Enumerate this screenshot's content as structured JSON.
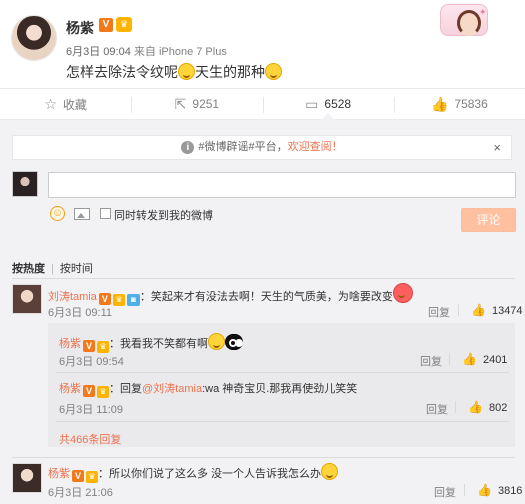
{
  "post": {
    "author": "杨紫",
    "vip_badge": "V",
    "date": "6月3日 09:04",
    "source_prefix": "来自",
    "source": "iPhone 7 Plus",
    "text_part1": "怎样去除法令纹呢",
    "text_part2": "天生的那种"
  },
  "actions": [
    {
      "icon": "star-icon",
      "label": "收藏"
    },
    {
      "icon": "repost-icon",
      "label": "9251"
    },
    {
      "icon": "comment-icon",
      "label": "6528"
    },
    {
      "icon": "like-icon",
      "label": "75836"
    }
  ],
  "notice": {
    "text": "#微博辟谣#平台，",
    "link": "欢迎查阅！",
    "close": "×"
  },
  "composer": {
    "repost_label": "同时转发到我的微博",
    "submit_label": "评论"
  },
  "sort": {
    "hot": "按热度",
    "time": "按时间"
  },
  "comments": [
    {
      "name": "刘涛tamia",
      "text": "：笑起来才有没法去啊！天生的气质美，为啥要改变",
      "date": "6月3日 09:11",
      "reply_label": "回复",
      "likes": "13474"
    }
  ],
  "replies": [
    {
      "name": "杨紫",
      "text": "：我看我不笑都有啊",
      "date": "6月3日 09:54",
      "reply_label": "回复",
      "likes": "2401"
    },
    {
      "name": "杨紫",
      "text_prefix": "：回复",
      "at": "@刘涛tamia",
      "text": ":wa 神奇宝贝.那我再使劲儿笑笑",
      "date": "6月3日 11:09",
      "reply_label": "回复",
      "likes": "802"
    }
  ],
  "more_replies": "共466条回复",
  "comment2": {
    "name": "杨紫",
    "text": "：所以你们说了这么多 没一个人告诉我怎么办",
    "date": "6月3日 21:06",
    "reply_label": "回复",
    "likes": "3816"
  },
  "colors": {
    "accent": "#eb7350",
    "vip": "#f27a1a",
    "bg_comments": "#f2f2f5"
  }
}
